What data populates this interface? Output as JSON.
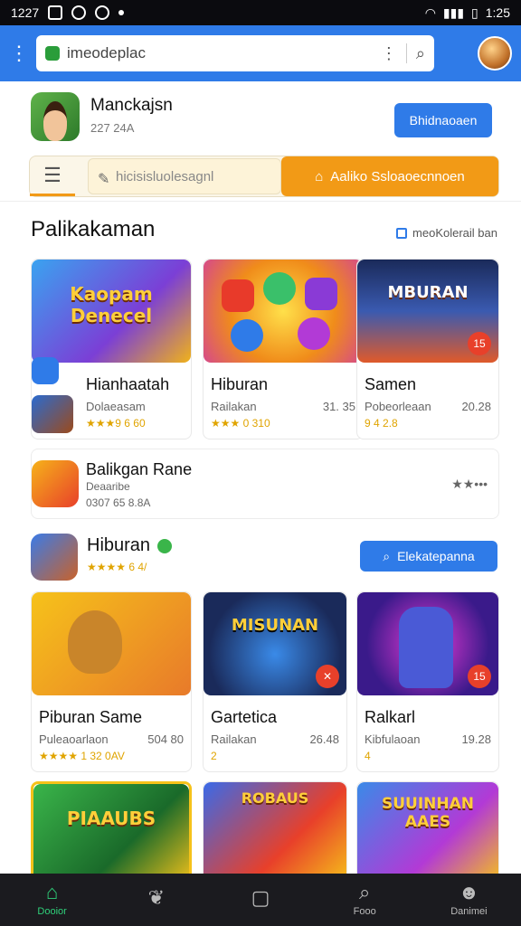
{
  "status": {
    "time": "1227",
    "clock": "1:25"
  },
  "search": {
    "value": "imeodeplac"
  },
  "profile": {
    "name": "Manckajsn",
    "sub": "227 24A",
    "button": "Bhidnaoaen"
  },
  "tabs": {
    "middle": "hicisisluolesagnl",
    "active": "Aaliko Ssloaoecnnoen"
  },
  "section": {
    "title": "Palikakaman",
    "link": "meoKolerail ban"
  },
  "cards_row1": [
    {
      "thumb_text": "Kaopam Denecel",
      "title": "Hianhaatah",
      "meta_left": "Dolaeasam",
      "meta_right": "",
      "stars": "★★★9 6 60"
    },
    {
      "thumb_text": "",
      "title": "Hiburan",
      "meta_left": "Railakan",
      "meta_right": "31. 35",
      "stars": "★★★ 0 310"
    },
    {
      "thumb_text": "MBURAN",
      "title": "Samen",
      "meta_left": "Pobeorleaan",
      "meta_right": "20.28",
      "stars": "9 4 2.8"
    }
  ],
  "feature_row": {
    "title": "Balikgan Rane",
    "sub1": "Deaaribe",
    "sub2": "0307 65 8.8A",
    "more": "★★•••"
  },
  "app_row": {
    "title": "Hiburan",
    "stars": "★★★★ 6 4/",
    "button": "Elekatepanna"
  },
  "cards_row2": [
    {
      "title": "Piburan Same",
      "meta_left": "Puleaoarlaon",
      "meta_right": "504 80",
      "stars": "★★★★ 1 32 0AV"
    },
    {
      "thumb_text": "MISUNAN",
      "title": "Gartetica",
      "meta_left": "Railakan",
      "meta_right": "26.48",
      "stars": "2"
    },
    {
      "thumb_text": "",
      "title": "Ralkarl",
      "meta_left": "Kibfulaoan",
      "meta_right": "19.28",
      "stars": "4"
    }
  ],
  "cards_row3": [
    {
      "thumb_text": "PIAAUBS"
    },
    {
      "thumb_text": "ROBAUS"
    },
    {
      "thumb_text": "SUUINHAN AAES"
    }
  ],
  "nav": [
    {
      "label": "Dooior",
      "icon": "home-icon"
    },
    {
      "label": "",
      "icon": "leaf-icon"
    },
    {
      "label": "",
      "icon": "square-icon"
    },
    {
      "label": "Fooo",
      "icon": "search-icon"
    },
    {
      "label": "Danimei",
      "icon": "person-icon"
    }
  ],
  "colors": {
    "accent": "#2f7be8",
    "orange": "#f29a16",
    "navActive": "#2fd07a"
  }
}
